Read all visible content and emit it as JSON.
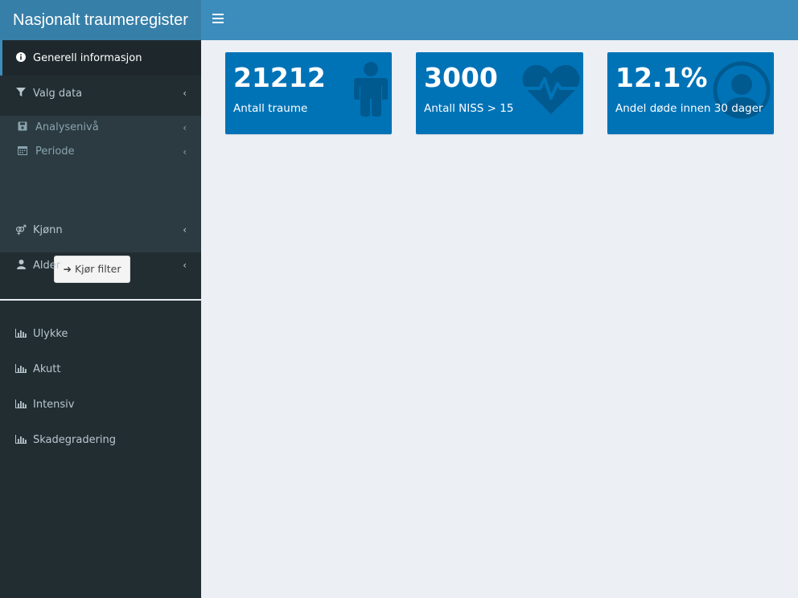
{
  "header": {
    "app_title": "Nasjonalt traumeregister",
    "menu_toggle_icon": "hamburger-icon"
  },
  "sidebar": {
    "generell": {
      "label": "Generell informasjon",
      "icon": "info-circle-icon"
    },
    "valg_data": {
      "label": "Valg data",
      "icon": "filter-icon"
    },
    "submenu": {
      "analyseniva": {
        "label": "Analysenivå",
        "icon": "save-icon"
      },
      "periode": {
        "label": "Periode",
        "icon": "calendar-icon"
      },
      "run_button": "Kjør filter"
    },
    "kjonn": {
      "label": "Kjønn",
      "icon": "gender-icon"
    },
    "alder": {
      "label": "Alder",
      "icon": "user-icon"
    },
    "reports": [
      {
        "label": "Ulykke",
        "icon": "bar-chart-icon"
      },
      {
        "label": "Akutt",
        "icon": "bar-chart-icon"
      },
      {
        "label": "Intensiv",
        "icon": "bar-chart-icon"
      },
      {
        "label": "Skadegradering",
        "icon": "bar-chart-icon"
      }
    ]
  },
  "cards": [
    {
      "value": "21212",
      "label": "Antall traume",
      "icon": "male-icon"
    },
    {
      "value": "3000",
      "label": "Antall NISS > 15",
      "icon": "heartbeat-icon"
    },
    {
      "value": "12.1%",
      "label": "Andel døde innen 30 dager",
      "icon": "user-circle-icon"
    }
  ],
  "colors": {
    "header_logo": "#367fa9",
    "header_bar": "#3c8dbc",
    "sidebar_bg": "#222d32",
    "card_bg": "#0073b7",
    "content_bg": "#ecf0f5"
  }
}
